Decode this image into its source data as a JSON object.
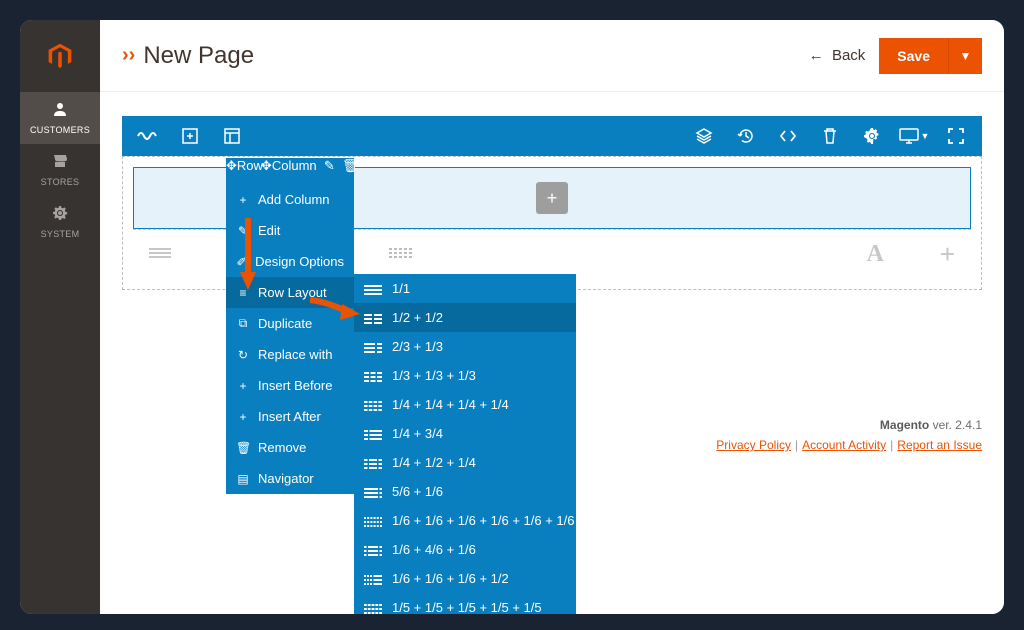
{
  "header": {
    "title_icon": "››",
    "title": "New Page",
    "back_label": "Back",
    "save_label": "Save"
  },
  "leftnav": {
    "items": [
      {
        "id": "customers",
        "label": "CUSTOMERS",
        "icon": "person",
        "active": true
      },
      {
        "id": "stores",
        "label": "STORES",
        "icon": "storefront",
        "active": false
      },
      {
        "id": "system",
        "label": "SYSTEM",
        "icon": "gear",
        "active": false
      }
    ]
  },
  "toolbar": {
    "tags": {
      "row": "Row",
      "column": "Column"
    },
    "right_tools": [
      "layers",
      "history",
      "code",
      "trash",
      "gear",
      "desktop",
      "fullscreen"
    ]
  },
  "context_menu": {
    "items": [
      {
        "id": "add-column",
        "label": "Add Column",
        "icon": "plus"
      },
      {
        "id": "edit",
        "label": "Edit",
        "icon": "pencil"
      },
      {
        "id": "design-options",
        "label": "Design Options",
        "icon": "brush"
      },
      {
        "id": "row-layout",
        "label": "Row Layout",
        "icon": "bars",
        "selected": true
      },
      {
        "id": "duplicate",
        "label": "Duplicate",
        "icon": "duplicate"
      },
      {
        "id": "replace-with",
        "label": "Replace with",
        "icon": "refresh"
      },
      {
        "id": "insert-before",
        "label": "Insert Before",
        "icon": "plus"
      },
      {
        "id": "insert-after",
        "label": "Insert After",
        "icon": "plus"
      },
      {
        "id": "remove",
        "label": "Remove",
        "icon": "trash"
      },
      {
        "id": "navigator",
        "label": "Navigator",
        "icon": "layers"
      }
    ]
  },
  "row_layout_submenu": {
    "options": [
      {
        "label": "1/1",
        "cols": 1
      },
      {
        "label": "1/2 + 1/2",
        "cols": 2,
        "hover": true
      },
      {
        "label": "2/3 + 1/3",
        "cols": 2
      },
      {
        "label": "1/3 + 1/3 + 1/3",
        "cols": 3
      },
      {
        "label": "1/4 + 1/4 + 1/4 + 1/4",
        "cols": 4
      },
      {
        "label": "1/4 + 3/4",
        "cols": 2
      },
      {
        "label": "1/4 + 1/2 + 1/4",
        "cols": 3
      },
      {
        "label": "5/6 + 1/6",
        "cols": 2
      },
      {
        "label": "1/6 + 1/6 + 1/6 + 1/6 + 1/6 + 1/6",
        "cols": 6
      },
      {
        "label": "1/6 + 4/6 + 1/6",
        "cols": 3
      },
      {
        "label": "1/6 + 1/6 + 1/6 + 1/2",
        "cols": 4
      },
      {
        "label": "1/5 + 1/5 + 1/5 + 1/5 + 1/5",
        "cols": 5
      }
    ]
  },
  "footer": {
    "product": "Magento",
    "version_prefix": "ver.",
    "version": "2.4.1",
    "links": {
      "privacy": "Privacy Policy",
      "activity": "Account Activity",
      "report": "Report an Issue"
    }
  },
  "colors": {
    "brand_orange": "#eb5202",
    "builder_blue": "#0a7fbf",
    "tag_blue": "#2f4a66",
    "nav_bg": "#373330"
  }
}
